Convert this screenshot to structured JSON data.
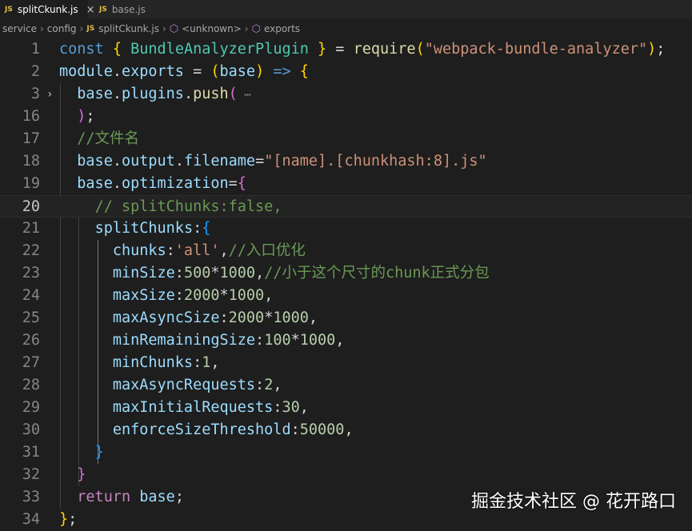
{
  "tabs": [
    {
      "icon": "JS",
      "label": "splitCkunk.js",
      "close": "×"
    },
    {
      "icon": "JS",
      "label": "base.js"
    }
  ],
  "breadcrumb": {
    "items": [
      "service",
      "config",
      "splitCkunk.js",
      "<unknown>",
      "exports"
    ],
    "file_icon": "JS"
  },
  "editor": {
    "lines": [
      {
        "n": "1",
        "tokens": [
          [
            "kw",
            "const"
          ],
          [
            "pl",
            " "
          ],
          [
            "p1",
            "{"
          ],
          [
            "pl",
            " "
          ],
          [
            "cls",
            "BundleAnalyzerPlugin"
          ],
          [
            "pl",
            " "
          ],
          [
            "p1",
            "}"
          ],
          [
            "pl",
            " = "
          ],
          [
            "fn",
            "require"
          ],
          [
            "p1",
            "("
          ],
          [
            "str",
            "\"webpack-bundle-analyzer\""
          ],
          [
            "p1",
            ")"
          ],
          [
            "pl",
            ";"
          ]
        ]
      },
      {
        "n": "2",
        "tokens": [
          [
            "vr",
            "module"
          ],
          [
            "pl",
            "."
          ],
          [
            "vr",
            "exports"
          ],
          [
            "pl",
            " = "
          ],
          [
            "p1",
            "("
          ],
          [
            "vr",
            "base"
          ],
          [
            "p1",
            ")"
          ],
          [
            "pl",
            " "
          ],
          [
            "kw",
            "=>"
          ],
          [
            "pl",
            " "
          ],
          [
            "p1",
            "{"
          ]
        ]
      },
      {
        "n": "3",
        "fold": true,
        "tokens": [
          [
            "pl",
            "  "
          ],
          [
            "vr",
            "base"
          ],
          [
            "pl",
            "."
          ],
          [
            "vr",
            "plugins"
          ],
          [
            "pl",
            "."
          ],
          [
            "fn",
            "push"
          ],
          [
            "p2",
            "("
          ],
          [
            "ell",
            " ⋯"
          ]
        ]
      },
      {
        "n": "16",
        "tokens": [
          [
            "pl",
            "  "
          ],
          [
            "p2",
            ")"
          ],
          [
            "pl",
            ";"
          ]
        ]
      },
      {
        "n": "17",
        "tokens": [
          [
            "pl",
            "  "
          ],
          [
            "cm",
            "//文件名"
          ]
        ]
      },
      {
        "n": "18",
        "tokens": [
          [
            "pl",
            "  "
          ],
          [
            "vr",
            "base"
          ],
          [
            "pl",
            "."
          ],
          [
            "vr",
            "output"
          ],
          [
            "pl",
            "."
          ],
          [
            "vr",
            "filename"
          ],
          [
            "pl",
            "="
          ],
          [
            "str",
            "\"[name].[chunkhash:8].js\""
          ]
        ]
      },
      {
        "n": "19",
        "tokens": [
          [
            "pl",
            "  "
          ],
          [
            "vr",
            "base"
          ],
          [
            "pl",
            "."
          ],
          [
            "vr",
            "optimization"
          ],
          [
            "pl",
            "="
          ],
          [
            "p2",
            "{"
          ]
        ]
      },
      {
        "n": "20",
        "current": true,
        "tokens": [
          [
            "pl",
            "    "
          ],
          [
            "cm",
            "// splitChunks:false,"
          ]
        ]
      },
      {
        "n": "21",
        "tokens": [
          [
            "pl",
            "    "
          ],
          [
            "vr",
            "splitChunks"
          ],
          [
            "pl",
            ":"
          ],
          [
            "p3",
            "{"
          ]
        ]
      },
      {
        "n": "22",
        "tokens": [
          [
            "pl",
            "      "
          ],
          [
            "vr",
            "chunks"
          ],
          [
            "pl",
            ":"
          ],
          [
            "str",
            "'all'"
          ],
          [
            "pl",
            ","
          ],
          [
            "cm",
            "//入口优化"
          ]
        ]
      },
      {
        "n": "23",
        "tokens": [
          [
            "pl",
            "      "
          ],
          [
            "vr",
            "minSize"
          ],
          [
            "pl",
            ":"
          ],
          [
            "num",
            "500"
          ],
          [
            "pl",
            "*"
          ],
          [
            "num",
            "1000"
          ],
          [
            "pl",
            ","
          ],
          [
            "cm",
            "//小于这个尺寸的chunk正式分包"
          ]
        ]
      },
      {
        "n": "24",
        "tokens": [
          [
            "pl",
            "      "
          ],
          [
            "vr",
            "maxSize"
          ],
          [
            "pl",
            ":"
          ],
          [
            "num",
            "2000"
          ],
          [
            "pl",
            "*"
          ],
          [
            "num",
            "1000"
          ],
          [
            "pl",
            ","
          ]
        ]
      },
      {
        "n": "25",
        "tokens": [
          [
            "pl",
            "      "
          ],
          [
            "vr",
            "maxAsyncSize"
          ],
          [
            "pl",
            ":"
          ],
          [
            "num",
            "2000"
          ],
          [
            "pl",
            "*"
          ],
          [
            "num",
            "1000"
          ],
          [
            "pl",
            ","
          ]
        ]
      },
      {
        "n": "26",
        "tokens": [
          [
            "pl",
            "      "
          ],
          [
            "vr",
            "minRemainingSize"
          ],
          [
            "pl",
            ":"
          ],
          [
            "num",
            "100"
          ],
          [
            "pl",
            "*"
          ],
          [
            "num",
            "1000"
          ],
          [
            "pl",
            ","
          ]
        ]
      },
      {
        "n": "27",
        "tokens": [
          [
            "pl",
            "      "
          ],
          [
            "vr",
            "minChunks"
          ],
          [
            "pl",
            ":"
          ],
          [
            "num",
            "1"
          ],
          [
            "pl",
            ","
          ]
        ]
      },
      {
        "n": "28",
        "tokens": [
          [
            "pl",
            "      "
          ],
          [
            "vr",
            "maxAsyncRequests"
          ],
          [
            "pl",
            ":"
          ],
          [
            "num",
            "2"
          ],
          [
            "pl",
            ","
          ]
        ]
      },
      {
        "n": "29",
        "tokens": [
          [
            "pl",
            "      "
          ],
          [
            "vr",
            "maxInitialRequests"
          ],
          [
            "pl",
            ":"
          ],
          [
            "num",
            "30"
          ],
          [
            "pl",
            ","
          ]
        ]
      },
      {
        "n": "30",
        "tokens": [
          [
            "pl",
            "      "
          ],
          [
            "vr",
            "enforceSizeThreshold"
          ],
          [
            "pl",
            ":"
          ],
          [
            "num",
            "50000"
          ],
          [
            "pl",
            ","
          ]
        ]
      },
      {
        "n": "31",
        "tokens": [
          [
            "pl",
            "    "
          ],
          [
            "p3",
            "}"
          ]
        ]
      },
      {
        "n": "32",
        "tokens": [
          [
            "pl",
            "  "
          ],
          [
            "p2",
            "}"
          ]
        ]
      },
      {
        "n": "33",
        "tokens": [
          [
            "pl",
            "  "
          ],
          [
            "kwc",
            "return"
          ],
          [
            "pl",
            " "
          ],
          [
            "vr",
            "base"
          ],
          [
            "pl",
            ";"
          ]
        ]
      },
      {
        "n": "34",
        "tokens": [
          [
            "p1",
            "}"
          ],
          [
            "pl",
            ";"
          ]
        ]
      }
    ]
  },
  "watermark": "掘金技术社区 @ 花开路口",
  "colors": {
    "background": "#1e1e1e",
    "keyword": "#569cd6",
    "string": "#ce9178",
    "number": "#b5cea8",
    "comment": "#6a9955",
    "variable": "#9cdcfe"
  }
}
